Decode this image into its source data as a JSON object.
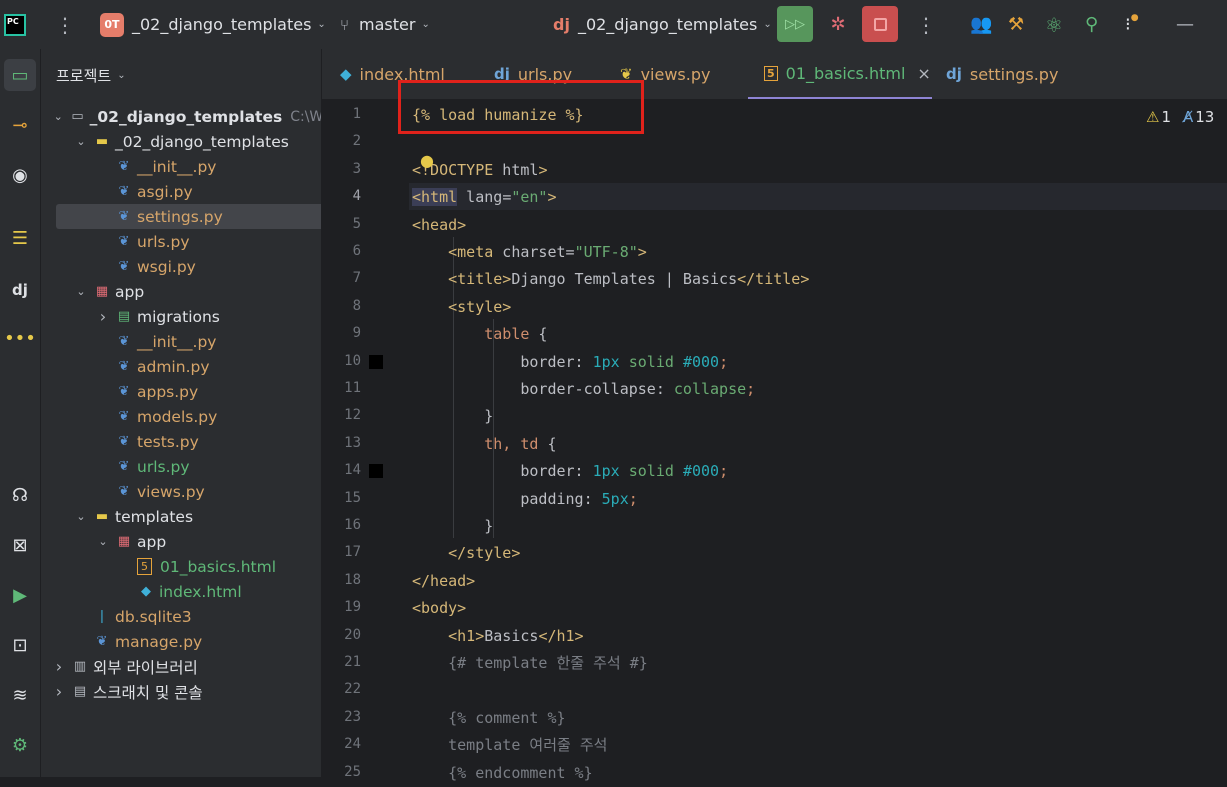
{
  "topbar": {
    "project_badge": "0T",
    "project_name": "_02_django_templates",
    "branch": "master",
    "run_config": "_02_django_templates",
    "run_config_icon": "dj"
  },
  "project_panel": {
    "title": "프로젝트",
    "tree": [
      {
        "label": "_02_django_templates",
        "hint": "C:\\Wo",
        "type": "root",
        "arrow": "v",
        "level": 0
      },
      {
        "label": "_02_django_templates",
        "type": "folder",
        "arrow": "v",
        "level": 1
      },
      {
        "label": "__init__.py",
        "type": "py",
        "color": "orange",
        "level": 2
      },
      {
        "label": "asgi.py",
        "type": "py",
        "color": "orange",
        "level": 2
      },
      {
        "label": "settings.py",
        "type": "py",
        "color": "orange",
        "level": 2,
        "selected": true
      },
      {
        "label": "urls.py",
        "type": "py",
        "color": "orange",
        "level": 2
      },
      {
        "label": "wsgi.py",
        "type": "py",
        "color": "orange",
        "level": 2
      },
      {
        "label": "app",
        "type": "app",
        "arrow": "v",
        "level": 1
      },
      {
        "label": "migrations",
        "type": "migrations",
        "arrow": ">",
        "level": 2
      },
      {
        "label": "__init__.py",
        "type": "py",
        "color": "orange",
        "level": 2
      },
      {
        "label": "admin.py",
        "type": "py",
        "color": "orange",
        "level": 2
      },
      {
        "label": "apps.py",
        "type": "py",
        "color": "orange",
        "level": 2
      },
      {
        "label": "models.py",
        "type": "py",
        "color": "orange",
        "level": 2
      },
      {
        "label": "tests.py",
        "type": "py",
        "color": "orange",
        "level": 2
      },
      {
        "label": "urls.py",
        "type": "py",
        "color": "green",
        "level": 2
      },
      {
        "label": "views.py",
        "type": "py",
        "color": "orange",
        "level": 2
      },
      {
        "label": "templates",
        "type": "templates",
        "arrow": "v",
        "level": 1
      },
      {
        "label": "app",
        "type": "app",
        "arrow": "v",
        "level": 2
      },
      {
        "label": "01_basics.html",
        "type": "html5",
        "color": "green",
        "level": 3
      },
      {
        "label": "index.html",
        "type": "djhtml",
        "color": "green",
        "level": 3
      },
      {
        "label": "db.sqlite3",
        "type": "sqlite",
        "color": "orange",
        "level": 1
      },
      {
        "label": "manage.py",
        "type": "py",
        "color": "orange",
        "level": 1
      },
      {
        "label": "외부 라이브러리",
        "type": "lib",
        "arrow": ">",
        "level": 0
      },
      {
        "label": "스크래치 및 콘솔",
        "type": "scratch",
        "arrow": ">",
        "level": 0
      }
    ]
  },
  "tabs": [
    {
      "label": "index.html",
      "icon": "django-html-icon"
    },
    {
      "label": "urls.py",
      "icon": "dj"
    },
    {
      "label": "views.py",
      "icon": "python-icon"
    },
    {
      "label": "01_basics.html",
      "icon": "html5-icon",
      "active": true,
      "close": "×"
    },
    {
      "label": "settings.py",
      "icon": "dj"
    }
  ],
  "inspections": {
    "warnings": "1",
    "typos": "13"
  },
  "editor": {
    "line_numbers": [
      "1",
      "2",
      "3",
      "4",
      "5",
      "6",
      "7",
      "8",
      "9",
      "10",
      "11",
      "12",
      "13",
      "14",
      "15",
      "16",
      "17",
      "18",
      "19",
      "20",
      "21",
      "22",
      "23",
      "24",
      "25"
    ],
    "lines": [
      [
        {
          "t": "{% load humanize %}",
          "c": "tpl"
        }
      ],
      [],
      [
        {
          "t": "<",
          "c": "tag"
        },
        {
          "t": "!DOCTYPE",
          "c": "tag"
        },
        {
          "t": " html",
          "c": "attr"
        },
        {
          "t": ">",
          "c": "tag"
        }
      ],
      [
        {
          "t": "<html",
          "c": "tag"
        },
        {
          "t": " lang",
          "c": "attr"
        },
        {
          "t": "=",
          "c": "attr"
        },
        {
          "t": "\"en\"",
          "c": "str"
        },
        {
          "t": ">",
          "c": "tag"
        }
      ],
      [
        {
          "t": "<head>",
          "c": "tag"
        }
      ],
      [
        {
          "t": "    "
        },
        {
          "t": "<meta",
          "c": "tag"
        },
        {
          "t": " charset",
          "c": "attr"
        },
        {
          "t": "=",
          "c": "attr"
        },
        {
          "t": "\"UTF-8\"",
          "c": "str"
        },
        {
          "t": ">",
          "c": "tag"
        }
      ],
      [
        {
          "t": "    "
        },
        {
          "t": "<title>",
          "c": "tag"
        },
        {
          "t": "Django Templates | Basics"
        },
        {
          "t": "</title>",
          "c": "tag"
        }
      ],
      [
        {
          "t": "    "
        },
        {
          "t": "<style>",
          "c": "tag"
        }
      ],
      [
        {
          "t": "        "
        },
        {
          "t": "table",
          "c": "kw"
        },
        {
          "t": " {"
        }
      ],
      [
        {
          "t": "            border: "
        },
        {
          "t": "1px",
          "c": "num"
        },
        {
          "t": " solid ",
          "c": "cssval"
        },
        {
          "t": "#000",
          "c": "num"
        },
        {
          "t": ";",
          "c": "kw"
        }
      ],
      [
        {
          "t": "            border-collapse: "
        },
        {
          "t": "collapse",
          "c": "cssval"
        },
        {
          "t": ";",
          "c": "kw"
        }
      ],
      [
        {
          "t": "        "
        },
        {
          "t": "}"
        }
      ],
      [
        {
          "t": "        "
        },
        {
          "t": "th, td",
          "c": "kw"
        },
        {
          "t": " {"
        }
      ],
      [
        {
          "t": "            border: "
        },
        {
          "t": "1px",
          "c": "num"
        },
        {
          "t": " solid ",
          "c": "cssval"
        },
        {
          "t": "#000",
          "c": "num"
        },
        {
          "t": ";",
          "c": "kw"
        }
      ],
      [
        {
          "t": "            padding: "
        },
        {
          "t": "5px",
          "c": "num"
        },
        {
          "t": ";",
          "c": "kw"
        }
      ],
      [
        {
          "t": "        "
        },
        {
          "t": "}"
        }
      ],
      [
        {
          "t": "    "
        },
        {
          "t": "</style>",
          "c": "tag"
        }
      ],
      [
        {
          "t": "</head>",
          "c": "tag"
        }
      ],
      [
        {
          "t": "<body>",
          "c": "tag"
        }
      ],
      [
        {
          "t": "    "
        },
        {
          "t": "<h1>",
          "c": "tag"
        },
        {
          "t": "Basics"
        },
        {
          "t": "</h1>",
          "c": "tag"
        }
      ],
      [
        {
          "t": "    "
        },
        {
          "t": "{# template 한줄 주석 #}",
          "c": "cmt"
        }
      ],
      [],
      [
        {
          "t": "    "
        },
        {
          "t": "{% comment %}",
          "c": "cmt"
        }
      ],
      [
        {
          "t": "    "
        },
        {
          "t": "template 여러줄 주석",
          "c": "cmt"
        }
      ],
      [
        {
          "t": "    "
        },
        {
          "t": "{% endcomment %}",
          "c": "cmt"
        }
      ]
    ]
  },
  "colors": {
    "accent": "#8e84d4",
    "run_green": "#57965c",
    "stop_red": "#c94f4f",
    "highlight_box": "#e0221b"
  }
}
